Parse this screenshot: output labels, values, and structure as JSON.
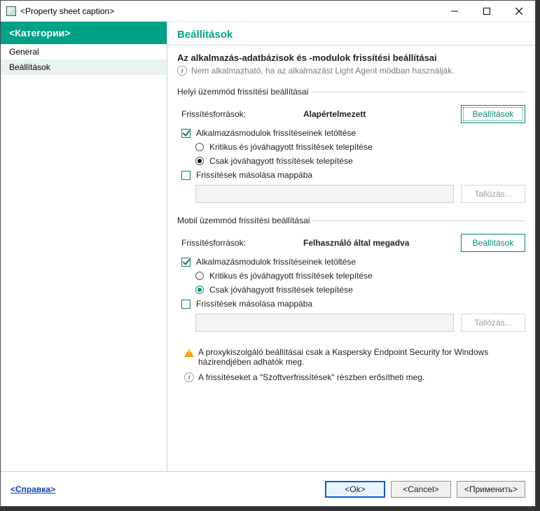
{
  "window": {
    "title": "<Property sheet caption>"
  },
  "sidebar": {
    "header": "<Категории>",
    "items": [
      {
        "label": "General"
      },
      {
        "label": "Beállítások"
      }
    ]
  },
  "main": {
    "title": "Beállítások",
    "subheading": "Az alkalmazás-adatbázisok és -modulok frissítési beállításai",
    "noteNotApplicable": "Nem alkalmazható, ha az alkalmazást Light Agent módban használják."
  },
  "groups": {
    "local": {
      "legend": "Helyi üzemmód frissítési beállításai",
      "sourcesLabel": "Frissítésforrások:",
      "sourcesValue": "Alapértelmezett",
      "settingsBtn": "Beállítások",
      "downloadModules": "Alkalmazásmodulok frissítéseinek letöltése",
      "radioCriticalApproved": "Kritikus és jóváhagyott frissítések telepítése",
      "radioApprovedOnly": "Csak jóváhagyott frissítések telepítése",
      "copyToFolder": "Frissítések másolása mappába",
      "pathValue": "",
      "browseBtn": "Tallózás..."
    },
    "mobile": {
      "legend": "Mobil üzemmód frissítési beállításai",
      "sourcesLabel": "Frissítésforrások:",
      "sourcesValue": "Felhasználó által megadva",
      "settingsBtn": "Beállítások",
      "downloadModules": "Alkalmazásmodulok frissítéseinek letöltése",
      "radioCriticalApproved": "Kritikus és jóváhagyott frissítések telepítése",
      "radioApprovedOnly": "Csak jóváhagyott frissítések telepítése",
      "copyToFolder": "Frissítések másolása mappába",
      "pathValue": "",
      "browseBtn": "Tallózás..."
    }
  },
  "notes": {
    "proxyWarning": "A proxykiszolgáló beállításai csak a Kaspersky Endpoint Security for Windows házirendjében adhatók meg.",
    "softwareUpdates": "A frissítéseket a \"Szoftverfrissítések\" részben erősítheti meg."
  },
  "footer": {
    "help": "<Справка>",
    "ok": "<Ok>",
    "cancel": "<Cancel>",
    "apply": "<Применить>"
  }
}
